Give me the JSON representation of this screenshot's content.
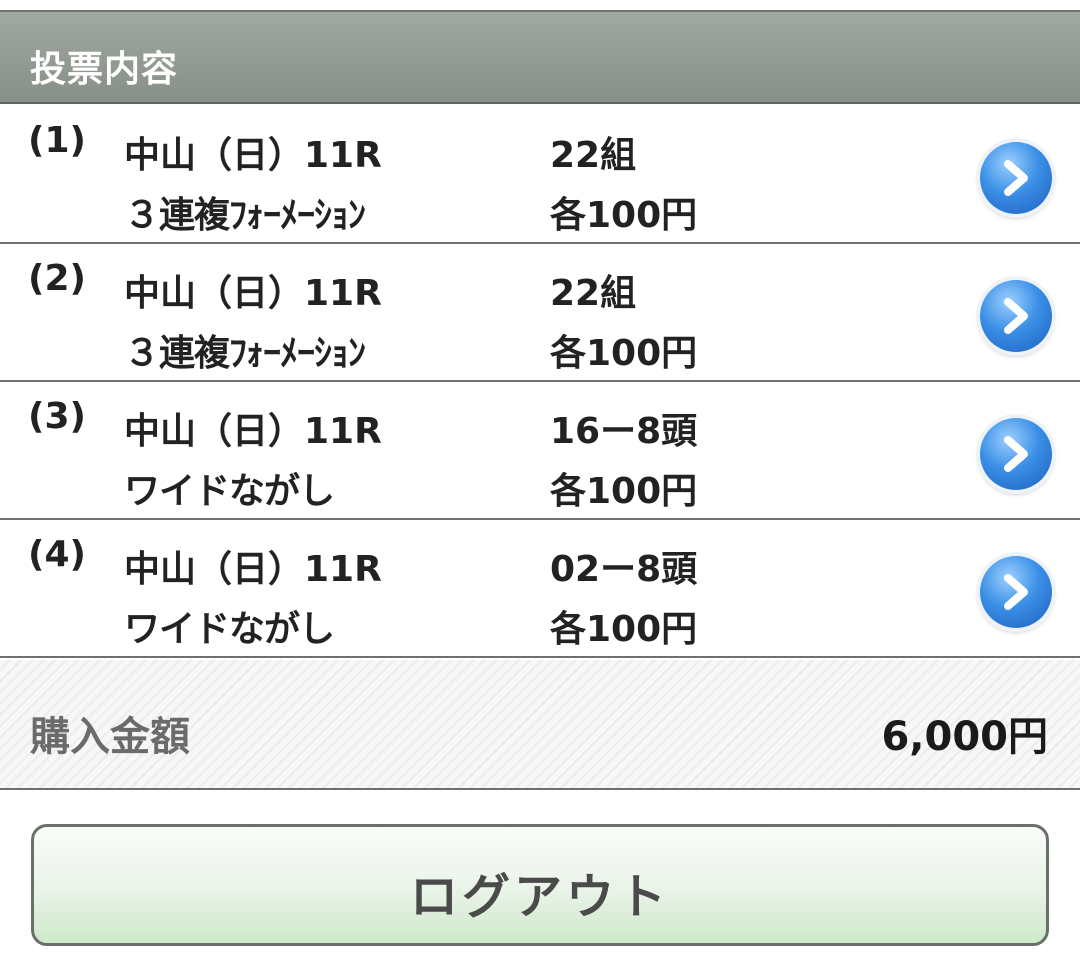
{
  "header": {
    "title": "投票内容"
  },
  "bets": [
    {
      "num": "(1)",
      "race": "中山（日）11R",
      "type": "３連複ﾌｫｰﾒｰｼｮﾝ",
      "combo": "22組",
      "amount": "各100円"
    },
    {
      "num": "(2)",
      "race": "中山（日）11R",
      "type": "３連複ﾌｫｰﾒｰｼｮﾝ",
      "combo": "22組",
      "amount": "各100円"
    },
    {
      "num": "(3)",
      "race": "中山（日）11R",
      "type": "ワイドながし",
      "combo": "16ー8頭",
      "amount": "各100円"
    },
    {
      "num": "(4)",
      "race": "中山（日）11R",
      "type": "ワイドながし",
      "combo": "02ー8頭",
      "amount": "各100円"
    }
  ],
  "total": {
    "label": "購入金額",
    "value": "6,000円"
  },
  "logout": {
    "label": "ログアウト"
  },
  "icons": {
    "detail": "chevron-right-circle-icon"
  },
  "colors": {
    "header_bg": "#8f988f",
    "accent_blue": "#2f7fd9",
    "logout_bg": "#dff0dc"
  }
}
